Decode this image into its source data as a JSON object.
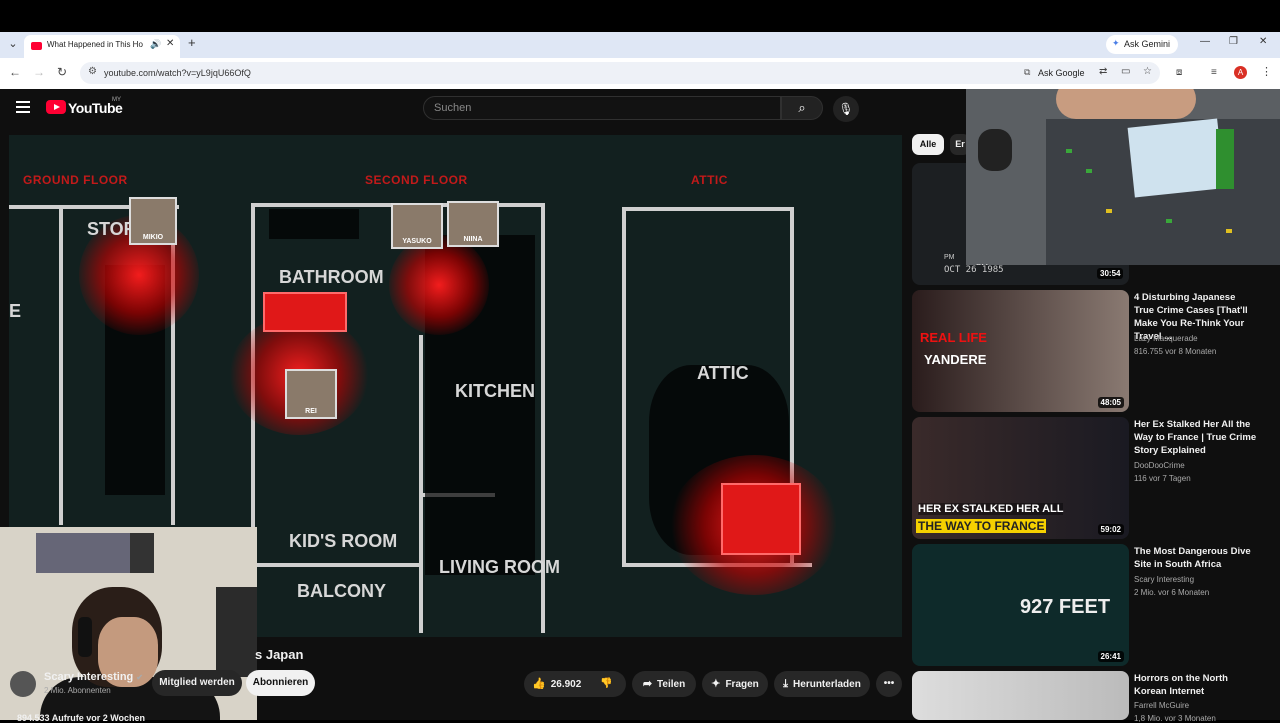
{
  "browser": {
    "tab_title": "What Happened in This Ho",
    "new_tab": "+",
    "ask_gemini": "Ask Gemini",
    "url": "youtube.com/watch?v=yL9jqU66OfQ",
    "ask_google": "Ask Google",
    "profile_initial": "A"
  },
  "youtube": {
    "logo_text": "YouTube",
    "country": "MY",
    "search_placeholder": "Suchen"
  },
  "video": {
    "floor_labels": [
      "GROUND FLOOR",
      "SECOND FLOOR",
      "ATTIC"
    ],
    "rooms": [
      "STOR",
      "BATHROOM",
      "KITCHEN",
      "ATTIC",
      "KID'S ROOM",
      "BALCONY",
      "LIVING ROOM",
      "E"
    ],
    "photo_labels": [
      "MIKIO",
      "YASUKO",
      "NIINA",
      "REI"
    ],
    "title_partial": "s Japan",
    "views": "894.533 Aufrufe  vor 2 Wochen"
  },
  "channel": {
    "name": "Scary Interesting",
    "subs": "2 Mio. Abonnenten",
    "join": "Mitglied werden",
    "subscribe": "Abonnieren"
  },
  "actions": {
    "likes": "26.902",
    "share": "Teilen",
    "ask": "Fragen",
    "download": "Herunterladen"
  },
  "chips": [
    "Alle",
    "Er"
  ],
  "pip": {
    "stamp": "OCT 26 1985",
    "stamp_prefix": "PM",
    "duration": "30:54"
  },
  "recommendations": [
    {
      "title": "4 Disturbing Japanese True Crime Cases [That'll Make You Re-Think Your Travel ...",
      "channel": "Lazy Masquerade",
      "meta": "816.755  vor 8 Monaten",
      "duration": "48:05",
      "thumb_text1": "REAL LIFE",
      "thumb_text2": "YANDERE"
    },
    {
      "title": "Her Ex Stalked Her All the Way to France | True Crime Story Explained",
      "channel": "DooDooCrime",
      "meta": "116  vor 7 Tagen",
      "duration": "59:02",
      "thumb_text1": "HER EX STALKED HER ALL",
      "thumb_text2": "THE WAY TO FRANCE"
    },
    {
      "title": "The Most Dangerous Dive Site in South Africa",
      "channel": "Scary Interesting",
      "meta": "2 Mio.  vor 6 Monaten",
      "duration": "26:41",
      "thumb_text1": "927 FEET",
      "thumb_text2": ""
    },
    {
      "title": "Horrors on the North Korean Internet",
      "channel": "Farrell McGuire",
      "meta": "1,8 Mio.  vor 3 Monaten",
      "duration": "",
      "thumb_text1": "",
      "thumb_text2": ""
    }
  ],
  "colors": {
    "accent": "#ff0033",
    "bg": "#0f0f0f",
    "floor_red": "#c21a1a"
  }
}
